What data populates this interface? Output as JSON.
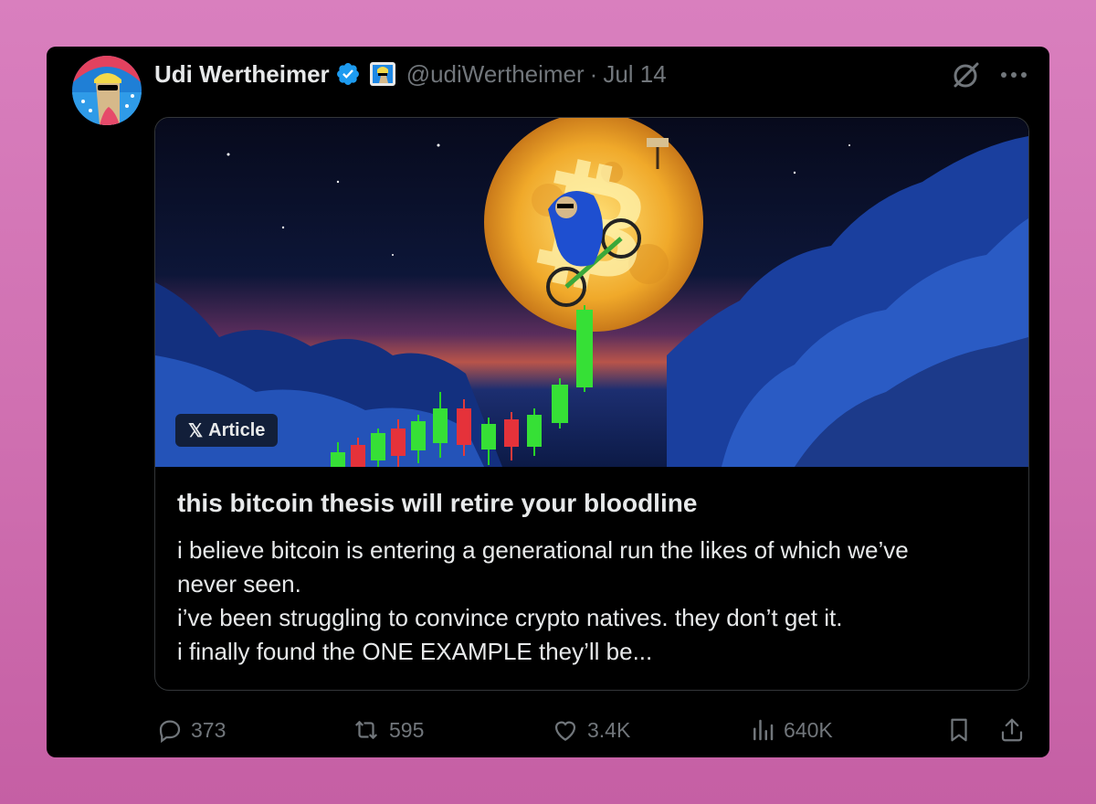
{
  "tweet": {
    "author_name": "Udi Wertheimer",
    "handle": "@udiWertheimer",
    "separator": "·",
    "date": "Jul 14"
  },
  "article": {
    "badge_label": "Article",
    "title": "this bitcoin thesis will retire your bloodline",
    "body_lines": [
      "i believe bitcoin is entering a generational run the likes of which we’ve",
      "never seen.",
      "i’ve been struggling to convince crypto natives. they don’t get it.",
      "i finally found the ONE EXAMPLE they’ll be..."
    ]
  },
  "actions": {
    "replies": "373",
    "reposts": "595",
    "likes": "3.4K",
    "views": "640K"
  },
  "colors": {
    "background": "#d97fbe",
    "card": "#000000",
    "text_primary": "#e7e9ea",
    "text_secondary": "#71767b",
    "verified_blue": "#1d9bf0"
  },
  "icons": [
    "verified-badge-icon",
    "grok-icon",
    "more-icon",
    "reply-icon",
    "repost-icon",
    "like-icon",
    "views-icon",
    "bookmark-icon",
    "share-icon",
    "x-logo-icon"
  ]
}
